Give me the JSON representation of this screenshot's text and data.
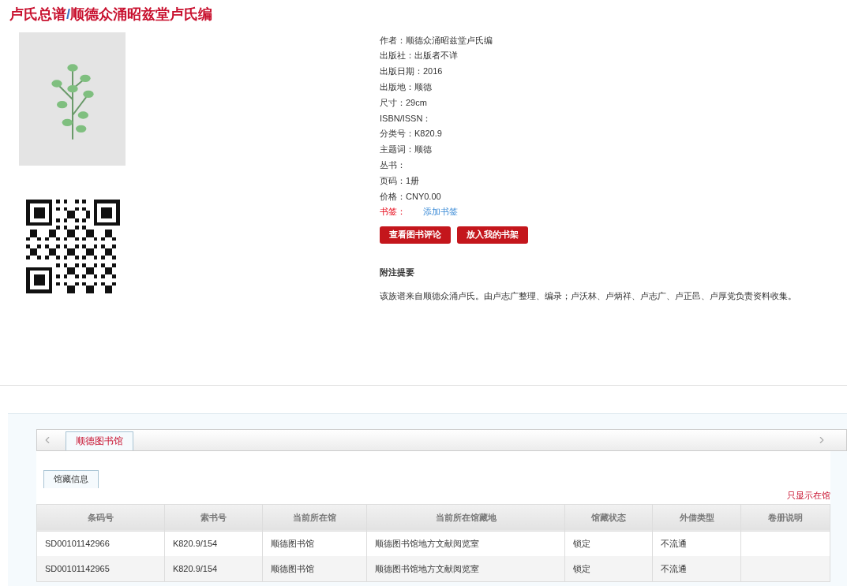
{
  "title": {
    "series": "卢氏总谱",
    "separator": "/",
    "name": "顺德众涌昭兹堂卢氏编"
  },
  "details": [
    {
      "kind": "text",
      "label": "作者：",
      "value": "顺德众涌昭兹堂卢氏编"
    },
    {
      "kind": "text",
      "label": "出版社：",
      "value": "出版者不详"
    },
    {
      "kind": "text",
      "label": "出版日期：",
      "value": "2016"
    },
    {
      "kind": "text",
      "label": "出版地：",
      "value": "顺德"
    },
    {
      "kind": "text",
      "label": "尺寸：",
      "value": "29cm"
    },
    {
      "kind": "text",
      "label": "ISBN/ISSN："
    },
    {
      "kind": "text",
      "label": "分类号：",
      "value": "K820.9"
    },
    {
      "kind": "text",
      "label": "主题词：",
      "value": "顺德"
    },
    {
      "kind": "text",
      "label": "丛书："
    },
    {
      "kind": "text",
      "label": "页码：",
      "value": "1册"
    },
    {
      "kind": "text",
      "label": "价格：",
      "value": "CNY0.00"
    },
    {
      "kind": "link",
      "label": "书签：",
      "value": "添加书签"
    }
  ],
  "buttons": [
    "查看图书评论",
    "放入我的书架"
  ],
  "notes": {
    "heading": "附注提要",
    "text": "该族谱来自顺德众涌卢氏。由卢志广整理、编录；卢沃林、卢炳祥、卢志广、卢正邑、卢厚党负责资料收集。"
  },
  "library_tabs": [
    {
      "label": "顺德图书馆",
      "selected": true
    }
  ],
  "sub_tabs": [
    {
      "label": "馆藏信息",
      "selected": true
    }
  ],
  "filter_link": "只显示在馆",
  "table": {
    "columns": [
      "条码号",
      "索书号",
      "当前所在馆",
      "当前所在馆藏地",
      "馆藏状态",
      "外借类型",
      "卷册说明"
    ],
    "rows": [
      [
        "SD00101142966",
        "K820.9/154",
        "顺德图书馆",
        "顺德图书馆地方文献阅览室",
        "锁定",
        "不流通",
        null
      ],
      [
        "SD00101142965",
        "K820.9/154",
        "顺德图书馆",
        "顺德图书馆地方文献阅览室",
        "锁定",
        "不流通",
        null
      ]
    ]
  }
}
